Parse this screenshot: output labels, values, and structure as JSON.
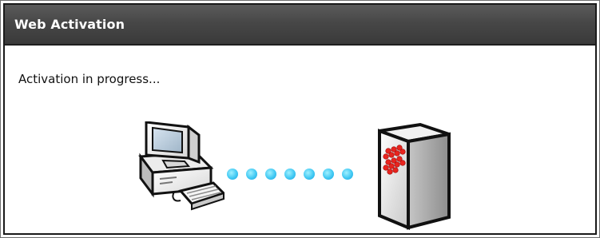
{
  "window": {
    "title": "Web Activation"
  },
  "content": {
    "status_text": "Activation in progress..."
  },
  "illustration": {
    "left_icon": "desktop-computer-icon",
    "right_icon": "firewall-server-icon",
    "connection_icon": "progress-dots-icon",
    "dot_color": "#42c9f3",
    "server_accent_color": "#e8241e"
  }
}
